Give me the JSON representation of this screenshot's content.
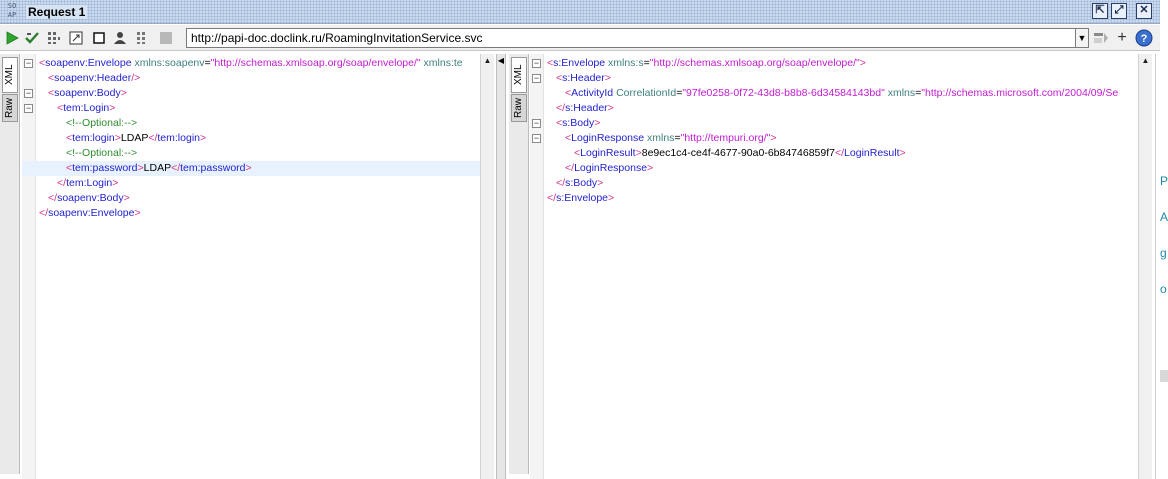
{
  "window": {
    "logo_top": "SO",
    "logo_bottom": "AP",
    "title": "Request 1",
    "buttons": {
      "detach": "⇱",
      "maximize": "⤢",
      "close": "✕"
    }
  },
  "toolbar": {
    "url": "http://papi-doc.doclink.ru/RoamingInvitationService.svc",
    "icons": [
      "run-icon",
      "check-icon",
      "wsa-icon",
      "expand-icon",
      "stop-icon",
      "user-icon",
      "wsrm-icon",
      "square-icon"
    ],
    "right_icons": [
      "header-icon",
      "add-icon",
      "help-icon"
    ],
    "add_label": "+",
    "help_label": "?"
  },
  "request_panel": {
    "tabs": [
      "XML",
      "Raw"
    ],
    "lines": [
      {
        "indent": 0,
        "fold": "−",
        "parts": [
          [
            "br",
            "<"
          ],
          [
            "tag",
            "soapenv:Envelope"
          ],
          [
            "attr",
            " xmlns:soapenv"
          ],
          [
            "txt",
            "="
          ],
          [
            "val",
            "\"http://schemas.xmlsoap.org/soap/envelope/\""
          ],
          [
            "attr",
            " xmlns:te"
          ]
        ]
      },
      {
        "indent": 1,
        "fold": "",
        "parts": [
          [
            "br",
            "<"
          ],
          [
            "tag",
            "soapenv:Header"
          ],
          [
            "br",
            "/>"
          ]
        ]
      },
      {
        "indent": 1,
        "fold": "−",
        "parts": [
          [
            "br",
            "<"
          ],
          [
            "tag",
            "soapenv:Body"
          ],
          [
            "br",
            ">"
          ]
        ]
      },
      {
        "indent": 2,
        "fold": "−",
        "parts": [
          [
            "br",
            "<"
          ],
          [
            "tag",
            "tem:Login"
          ],
          [
            "br",
            ">"
          ]
        ]
      },
      {
        "indent": 3,
        "fold": "",
        "parts": [
          [
            "cmt",
            "<!--Optional:-->"
          ]
        ]
      },
      {
        "indent": 3,
        "fold": "",
        "parts": [
          [
            "br",
            "<"
          ],
          [
            "tag",
            "tem:login"
          ],
          [
            "br",
            ">"
          ],
          [
            "txt",
            "LDAP"
          ],
          [
            "br",
            "</"
          ],
          [
            "tag",
            "tem:login"
          ],
          [
            "br",
            ">"
          ]
        ]
      },
      {
        "indent": 3,
        "fold": "",
        "parts": [
          [
            "cmt",
            "<!--Optional:-->"
          ]
        ]
      },
      {
        "indent": 3,
        "fold": "",
        "hl": true,
        "parts": [
          [
            "br",
            "<"
          ],
          [
            "tag",
            "tem:password"
          ],
          [
            "br",
            ">"
          ],
          [
            "txt",
            "LDAP"
          ],
          [
            "br",
            "</"
          ],
          [
            "tag",
            "tem:password"
          ],
          [
            "br",
            ">"
          ]
        ]
      },
      {
        "indent": 2,
        "fold": "",
        "parts": [
          [
            "br",
            "</"
          ],
          [
            "tag",
            "tem:Login"
          ],
          [
            "br",
            ">"
          ]
        ]
      },
      {
        "indent": 1,
        "fold": "",
        "parts": [
          [
            "br",
            "</"
          ],
          [
            "tag",
            "soapenv:Body"
          ],
          [
            "br",
            ">"
          ]
        ]
      },
      {
        "indent": 0,
        "fold": "",
        "parts": [
          [
            "br",
            "</"
          ],
          [
            "tag",
            "soapenv:Envelope"
          ],
          [
            "br",
            ">"
          ]
        ]
      }
    ]
  },
  "response_panel": {
    "tabs": [
      "XML",
      "Raw"
    ],
    "lines": [
      {
        "indent": 0,
        "fold": "−",
        "parts": [
          [
            "br",
            "<"
          ],
          [
            "tag",
            "s:Envelope"
          ],
          [
            "attr",
            " xmlns:s"
          ],
          [
            "txt",
            "="
          ],
          [
            "val",
            "\"http://schemas.xmlsoap.org/soap/envelope/\""
          ],
          [
            "br",
            ">"
          ]
        ]
      },
      {
        "indent": 1,
        "fold": "−",
        "parts": [
          [
            "br",
            "<"
          ],
          [
            "tag",
            "s:Header"
          ],
          [
            "br",
            ">"
          ]
        ]
      },
      {
        "indent": 2,
        "fold": "",
        "parts": [
          [
            "br",
            "<"
          ],
          [
            "tag",
            "ActivityId"
          ],
          [
            "attr",
            " CorrelationId"
          ],
          [
            "txt",
            "="
          ],
          [
            "val",
            "\"97fe0258-0f72-43d8-b8b8-6d34584143bd\""
          ],
          [
            "attr",
            " xmlns"
          ],
          [
            "txt",
            "="
          ],
          [
            "val",
            "\"http://schemas.microsoft.com/2004/09/Se"
          ]
        ]
      },
      {
        "indent": 1,
        "fold": "",
        "parts": [
          [
            "br",
            "</"
          ],
          [
            "tag",
            "s:Header"
          ],
          [
            "br",
            ">"
          ]
        ]
      },
      {
        "indent": 1,
        "fold": "−",
        "parts": [
          [
            "br",
            "<"
          ],
          [
            "tag",
            "s:Body"
          ],
          [
            "br",
            ">"
          ]
        ]
      },
      {
        "indent": 2,
        "fold": "−",
        "parts": [
          [
            "br",
            "<"
          ],
          [
            "tag",
            "LoginResponse"
          ],
          [
            "attr",
            " xmlns"
          ],
          [
            "txt",
            "="
          ],
          [
            "val",
            "\"http://tempuri.org/\""
          ],
          [
            "br",
            ">"
          ]
        ]
      },
      {
        "indent": 3,
        "fold": "",
        "parts": [
          [
            "br",
            "<"
          ],
          [
            "tag",
            "LoginResult"
          ],
          [
            "br",
            ">"
          ],
          [
            "txt",
            "8e9ec1c4-ce4f-4677-90a0-6b84746859f7"
          ],
          [
            "br",
            "</"
          ],
          [
            "tag",
            "LoginResult"
          ],
          [
            "br",
            ">"
          ]
        ]
      },
      {
        "indent": 2,
        "fold": "",
        "parts": [
          [
            "br",
            "</"
          ],
          [
            "tag",
            "LoginResponse"
          ],
          [
            "br",
            ">"
          ]
        ]
      },
      {
        "indent": 1,
        "fold": "",
        "parts": [
          [
            "br",
            "</"
          ],
          [
            "tag",
            "s:Body"
          ],
          [
            "br",
            ">"
          ]
        ]
      },
      {
        "indent": 0,
        "fold": "",
        "parts": [
          [
            "br",
            "</"
          ],
          [
            "tag",
            "s:Envelope"
          ],
          [
            "br",
            ">"
          ]
        ]
      }
    ]
  },
  "edge_peek": [
    "P",
    "A",
    "g",
    "o"
  ],
  "colors": {
    "tag": "#1f1fcf",
    "bracket": "#d0308a",
    "attribute": "#3f7f7f",
    "value": "#c21bd0",
    "comment": "#2e8b2e",
    "titlebar": "#c9d9ee"
  }
}
